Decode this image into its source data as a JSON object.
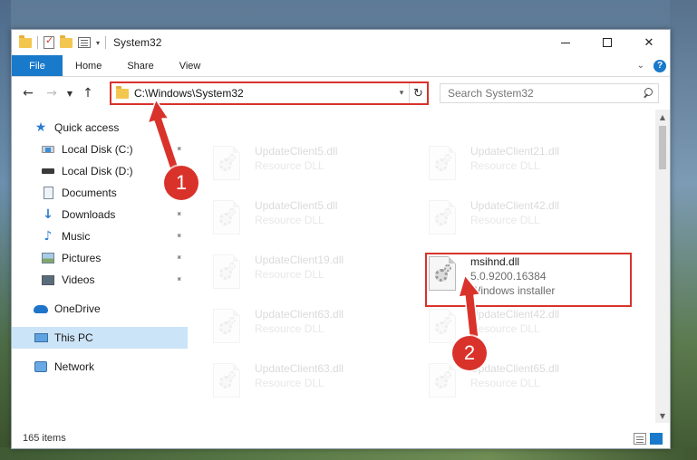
{
  "window": {
    "title": "System32"
  },
  "ribbon": {
    "tabs": [
      "File",
      "Home",
      "Share",
      "View"
    ],
    "help_label": "?"
  },
  "navigation": {
    "address": "C:\\Windows\\System32",
    "search_placeholder": "Search System32"
  },
  "sidebar": {
    "items": [
      {
        "label": "Quick access",
        "icon": "star-icon",
        "pinned": false
      },
      {
        "label": "Local Disk (C:)",
        "icon": "drive-c-icon",
        "pinned": true
      },
      {
        "label": "Local Disk (D:)",
        "icon": "drive-d-icon",
        "pinned": false
      },
      {
        "label": "Documents",
        "icon": "documents-icon",
        "pinned": true
      },
      {
        "label": "Downloads",
        "icon": "downloads-icon",
        "pinned": true
      },
      {
        "label": "Music",
        "icon": "music-icon",
        "pinned": true
      },
      {
        "label": "Pictures",
        "icon": "pictures-icon",
        "pinned": true
      },
      {
        "label": "Videos",
        "icon": "videos-icon",
        "pinned": true
      },
      {
        "label": "OneDrive",
        "icon": "onedrive-icon",
        "pinned": false
      },
      {
        "label": "This PC",
        "icon": "this-pc-icon",
        "pinned": false,
        "selected": true
      },
      {
        "label": "Network",
        "icon": "network-icon",
        "pinned": false
      }
    ]
  },
  "files": [
    {
      "name": "UpdateClient5.dll",
      "type": "Resource DLL",
      "faded": true
    },
    {
      "name": "UpdateClient21.dll",
      "type": "Resource DLL",
      "faded": true
    },
    {
      "name": "UpdateClient5.dll",
      "type": "Resource DLL",
      "faded": true
    },
    {
      "name": "UpdateClient42.dll",
      "type": "Resource DLL",
      "faded": true
    },
    {
      "name": "UpdateClient19.dll",
      "type": "Resource DLL",
      "faded": true
    },
    {
      "name": "msihnd.dll",
      "version": "5.0.9200.16384",
      "type": "Windows installer",
      "faded": false
    },
    {
      "name": "UpdateClient63.dll",
      "type": "Resource DLL",
      "faded": true
    },
    {
      "name": "UpdateClient42.dll",
      "type": "Resource DLL",
      "faded": true
    },
    {
      "name": "UpdateClient63.dll",
      "type": "Resource DLL",
      "faded": true
    },
    {
      "name": "UpdateClient65.dll",
      "type": "Resource DLL",
      "faded": true
    }
  ],
  "status": {
    "item_count": "165 items"
  },
  "annotations": {
    "step1": "1",
    "step2": "2",
    "color": "#d9322b"
  },
  "colors": {
    "accent": "#1979ca",
    "selected_nav": "#cce4f7"
  }
}
